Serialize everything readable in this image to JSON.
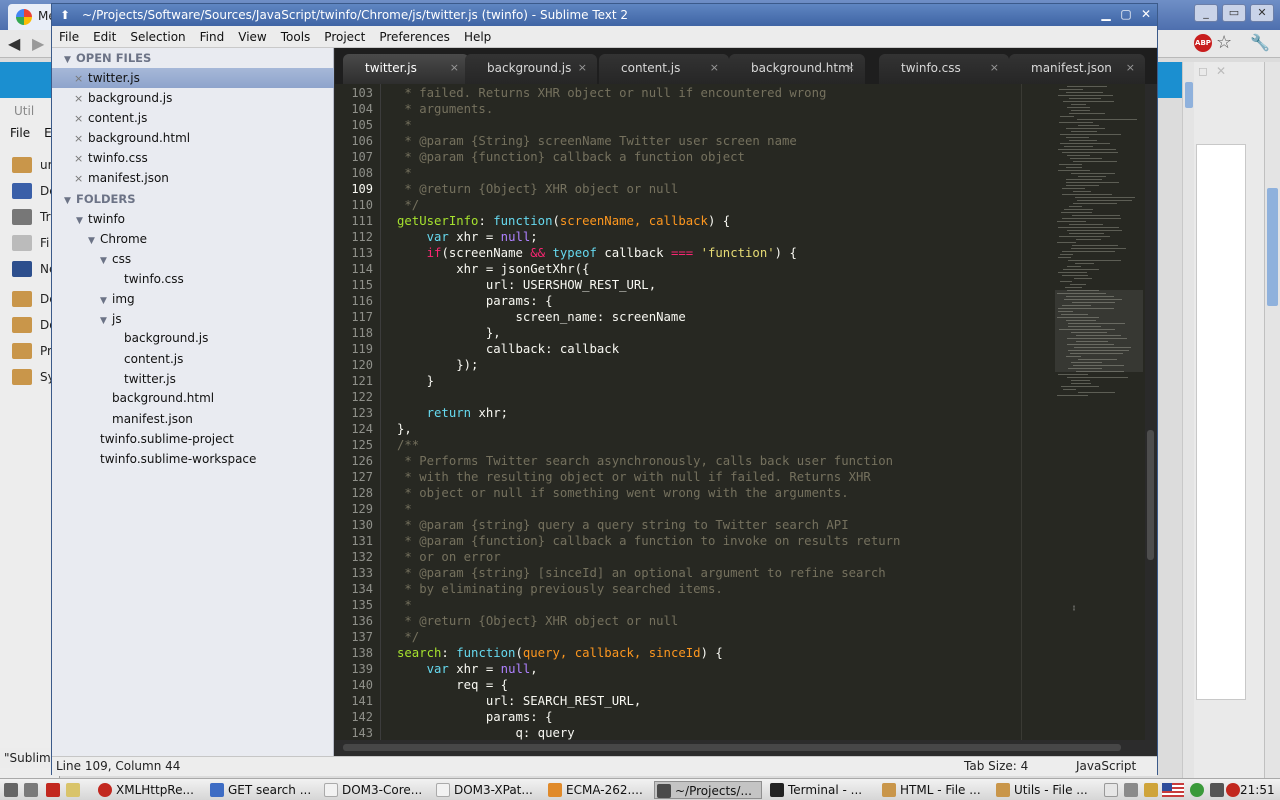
{
  "window": {
    "title": "~/Projects/Software/Sources/JavaScript/twinfo/Chrome/js/twitter.js (twinfo) - Sublime Text 2"
  },
  "menu": [
    "File",
    "Edit",
    "Selection",
    "Find",
    "View",
    "Tools",
    "Project",
    "Preferences",
    "Help"
  ],
  "sidebar": {
    "open_files_header": "OPEN FILES",
    "open_files": [
      "twitter.js",
      "background.js",
      "content.js",
      "background.html",
      "twinfo.css",
      "manifest.json"
    ],
    "folders_header": "FOLDERS",
    "tree": [
      {
        "label": "twinfo",
        "type": "folder"
      },
      {
        "label": "Chrome",
        "type": "folder"
      },
      {
        "label": "css",
        "type": "folder"
      },
      {
        "label": "twinfo.css",
        "type": "file"
      },
      {
        "label": "img",
        "type": "folder"
      },
      {
        "label": "js",
        "type": "folder"
      },
      {
        "label": "background.js",
        "type": "file"
      },
      {
        "label": "content.js",
        "type": "file"
      },
      {
        "label": "twitter.js",
        "type": "file"
      },
      {
        "label": "background.html",
        "type": "file"
      },
      {
        "label": "manifest.json",
        "type": "file"
      },
      {
        "label": "twinfo.sublime-project",
        "type": "file"
      },
      {
        "label": "twinfo.sublime-workspace",
        "type": "file"
      }
    ]
  },
  "tabs": [
    "twitter.js",
    "background.js",
    "content.js",
    "background.html",
    "twinfo.css",
    "manifest.json"
  ],
  "editor": {
    "current_line": "109",
    "line_numbers": [
      "103",
      "104",
      "105",
      "106",
      "107",
      "108",
      "109",
      "110",
      "111",
      "112",
      "113",
      "114",
      "115",
      "116",
      "117",
      "118",
      "119",
      "120",
      "121",
      "122",
      "123",
      "124",
      "125",
      "126",
      "127",
      "128",
      "129",
      "130",
      "131",
      "132",
      "133",
      "134",
      "135",
      "136",
      "137",
      "138",
      "139",
      "140",
      "141",
      "142",
      "143"
    ],
    "code": {
      "l103": " * failed. Returns XHR object or null if encountered wrong",
      "l104": " * arguments.",
      "l105": " *",
      "l106": " * @param {String} screenName Twitter user screen name",
      "l107": " * @param {function} callback a function object",
      "l108": " *",
      "l109": " * @return {Object} XHR object or null",
      "l110": " */",
      "l111a": "getUserInfo",
      "l111b": ": ",
      "l111c": "function",
      "l111d": "(",
      "l111e": "screenName, callback",
      "l111f": ") {",
      "l112a": "    ",
      "l112b": "var",
      "l112c": " xhr = ",
      "l112d": "null",
      "l112e": ";",
      "l113a": "    ",
      "l113b": "if",
      "l113c": "(screenName ",
      "l113d": "&&",
      "l113e": " ",
      "l113f": "typeof",
      "l113g": " callback ",
      "l113h": "===",
      "l113i": " ",
      "l113j": "'function'",
      "l113k": ") {",
      "l114": "        xhr = jsonGetXhr({",
      "l115": "            url: USERSHOW_REST_URL,",
      "l116": "            params: {",
      "l117": "                screen_name: screenName",
      "l118": "            },",
      "l119": "            callback: callback",
      "l120": "        });",
      "l121": "    }",
      "l122": "",
      "l123a": "    ",
      "l123b": "return",
      "l123c": " xhr;",
      "l124": "},",
      "l125": "/**",
      "l126": " * Performs Twitter search asynchronously, calls back user function",
      "l127": " * with the resulting object or with null if failed. Returns XHR",
      "l128": " * object or null if something went wrong with the arguments.",
      "l129": " *",
      "l130": " * @param {string} query a query string to Twitter search API",
      "l131": " * @param {function} callback a function to invoke on results return",
      "l132": " * or on error",
      "l133": " * @param {string} [sinceId] an optional argument to refine search",
      "l134": " * by eliminating previously searched items.",
      "l135": " *",
      "l136": " * @return {Object} XHR object or null",
      "l137": " */",
      "l138a": "search",
      "l138b": ": ",
      "l138c": "function",
      "l138d": "(",
      "l138e": "query, callback, sinceId",
      "l138f": ") {",
      "l139a": "    ",
      "l139b": "var",
      "l139c": " xhr = ",
      "l139d": "null",
      "l139e": ",",
      "l140": "        req = {",
      "l141": "            url: SEARCH_REST_URL,",
      "l142": "            params: {",
      "l143": "                q: query"
    }
  },
  "statusbar": {
    "position": "Line 109, Column 44",
    "tab_size": "Tab Size: 4",
    "syntax": "JavaScript"
  },
  "background": {
    "browser_tab": "Me",
    "window2_title": "Util",
    "window2_menu": [
      "File",
      "E"
    ],
    "window2_items": [
      "ur",
      "De",
      "Tr",
      "Fi",
      "Ne",
      "De",
      "Do",
      "Pr",
      "Sy"
    ],
    "window2_status": "\"Sublime",
    "abp_label": "ABP"
  },
  "taskbar": {
    "items": [
      "XMLHttpRe...",
      "GET search ...",
      "DOM3-Core...",
      "DOM3-XPat...",
      "ECMA-262....",
      "~/Projects/...",
      "Terminal - ...",
      "HTML - File ...",
      "Utils - File ..."
    ],
    "clock": "21:51"
  }
}
